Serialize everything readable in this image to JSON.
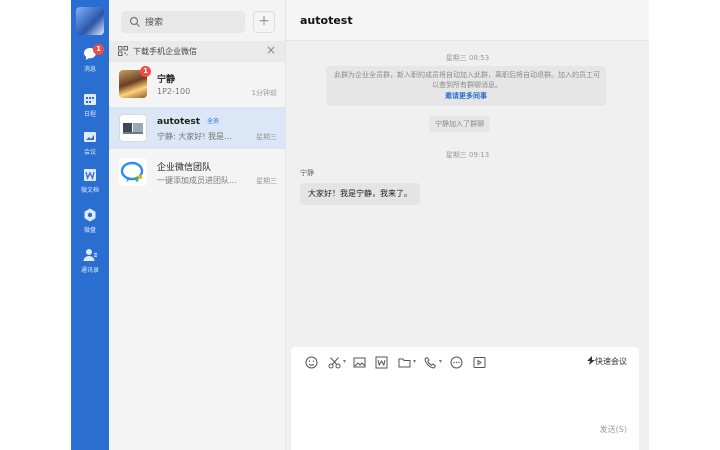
{
  "nav": {
    "badge": "1",
    "items": [
      {
        "label": "消息",
        "icon": "message-icon"
      },
      {
        "label": "日程",
        "icon": "calendar-icon"
      },
      {
        "label": "会议",
        "icon": "meeting-icon"
      },
      {
        "label": "微文档",
        "icon": "document-icon"
      },
      {
        "label": "微盘",
        "icon": "drive-icon"
      },
      {
        "label": "通讯录",
        "icon": "contacts-icon"
      }
    ]
  },
  "list": {
    "search_placeholder": "搜索",
    "add_label": "+",
    "banner": {
      "text": "下载手机企业微信",
      "close": "×"
    },
    "conversations": [
      {
        "name": "宁静",
        "sub": "1P2-100",
        "time": "1分钟前",
        "badge": "1"
      },
      {
        "name": "autotest",
        "tag": "全员",
        "sub": "宁静: 大家好! 我是...",
        "time": "星期三"
      },
      {
        "name": "企业微信团队",
        "sub": "一键添加成员进团队...",
        "time": "星期三"
      }
    ]
  },
  "chat": {
    "title": "autotest",
    "time1": "星期三 08:53",
    "notice_text": "此群为企业全员群，新入职的成员将自动加入此群，离职后将自动退群。加入的员工可以查到所有群聊消息。",
    "notice_link": "邀请更多同事",
    "joined": "宁静加入了群聊",
    "time2": "星期三 09:13",
    "sender": "宁静",
    "message": "大家好！我是宁静，我来了。"
  },
  "composer": {
    "tools": [
      "emoji-icon",
      "scissors-icon",
      "image-icon",
      "word-icon",
      "folder-icon",
      "phone-icon",
      "more-icon",
      "screen-icon"
    ],
    "quick_meeting": "快速会议",
    "send_label": "发送(S)"
  }
}
